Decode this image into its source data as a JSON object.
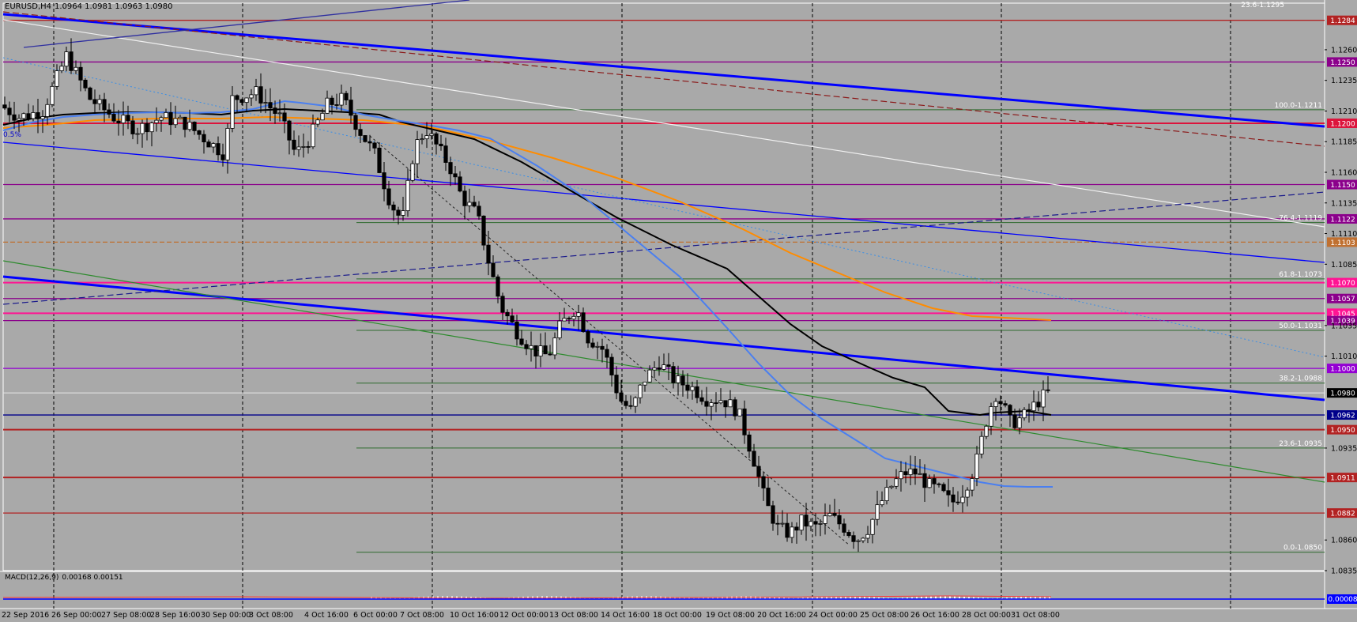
{
  "window": {
    "title": "EURUSD,H4",
    "ohlc": "1.0964 1.0981 1.0963 1.0980"
  },
  "chart_data": {
    "type": "candlestick",
    "symbol": "EURUSD",
    "timeframe": "H4",
    "ylim": [
      1.0835,
      1.1298
    ],
    "price_ticks": [
      1.126,
      1.1235,
      1.121,
      1.1185,
      1.116,
      1.1135,
      1.111,
      1.1085,
      1.1035,
      1.101,
      1.0935,
      1.086,
      1.0835
    ],
    "time_labels": [
      "22 Sep 2016",
      "26 Sep 00:00",
      "27 Sep 08:00",
      "28 Sep 16:00",
      "30 Sep 00:00",
      "3 Oct 08:00",
      "4 Oct 16:00",
      "6 Oct 00:00",
      "7 Oct 08:00",
      "10 Oct 16:00",
      "12 Oct 00:00",
      "13 Oct 08:00",
      "14 Oct 16:00",
      "18 Oct 00:00",
      "19 Oct 08:00",
      "20 Oct 16:00",
      "24 Oct 00:00",
      "25 Oct 08:00",
      "26 Oct 16:00",
      "28 Oct 00:00",
      "31 Oct 08:00"
    ],
    "current_price": "1.0980",
    "horizontal_levels": [
      {
        "price": 1.1284,
        "label": "1.1284",
        "color": "#b22222"
      },
      {
        "price": 1.125,
        "label": "1.1250",
        "color": "#8b008b"
      },
      {
        "price": 1.12,
        "label": "1.1200",
        "color": "#dc143c"
      },
      {
        "price": 1.115,
        "label": "1.1150",
        "color": "#8b008b"
      },
      {
        "price": 1.1122,
        "label": "1.1122",
        "color": "#8b008b"
      },
      {
        "price": 1.1103,
        "label": "1.1103",
        "color": "#c07030"
      },
      {
        "price": 1.107,
        "label": "1.1070",
        "color": "#ff1493"
      },
      {
        "price": 1.1057,
        "label": "1.1057",
        "color": "#8b008b"
      },
      {
        "price": 1.1045,
        "label": "1.1045",
        "color": "#ff1493"
      },
      {
        "price": 1.1039,
        "label": "1.1039",
        "color": "#8b008b"
      },
      {
        "price": 1.1,
        "label": "1.1000",
        "color": "#9400d3"
      },
      {
        "price": 1.0962,
        "label": "1.0962",
        "color": "#00008b"
      },
      {
        "price": 1.095,
        "label": "1.0950",
        "color": "#b22222"
      },
      {
        "price": 1.0911,
        "label": "1.0911",
        "color": "#b22222"
      },
      {
        "price": 1.0882,
        "label": "1.0882",
        "color": "#b22222"
      }
    ],
    "fib_levels": [
      {
        "price": 1.1211,
        "label": "100.0-1.1211"
      },
      {
        "price": 1.1119,
        "label": "76.4-1.1119"
      },
      {
        "price": 1.1073,
        "label": "61.8-1.1073"
      },
      {
        "price": 1.1031,
        "label": "50.0-1.1031"
      },
      {
        "price": 1.0988,
        "label": "38.2-1.0988"
      },
      {
        "price": 1.0935,
        "label": "23.6-1.0935"
      },
      {
        "price": 1.085,
        "label": "0.0-1.0850"
      }
    ],
    "fib_top_label": "23.6-1.1295",
    "left_label": "0.5%",
    "indicator": {
      "name": "MACD(12,26,9)",
      "values": "0.00168 0.00151",
      "label": "0.00008"
    },
    "colors": {
      "background": "#a9a9a9",
      "ma_black": "#000000",
      "ma_blue": "#4a7ff0",
      "ma_orange": "#ff8c00",
      "trend_blue": "#0000ff"
    }
  }
}
